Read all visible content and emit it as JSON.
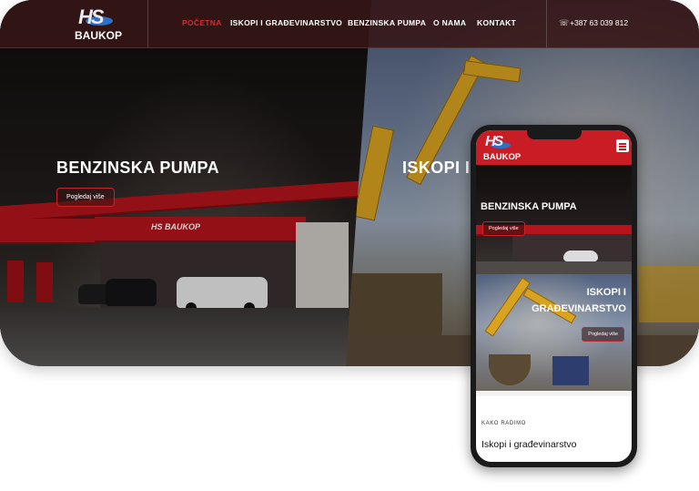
{
  "brand": {
    "mark": "HS",
    "name": "BAUKOP",
    "accent": "#c81d24",
    "logo_blue": "#2d6fc4"
  },
  "nav": {
    "items": [
      {
        "label": "POČETNA",
        "active": true
      },
      {
        "label": "ISKOPI I GRAĐEVINARSTVO",
        "active": false
      },
      {
        "label": "BENZINSKA PUMPA",
        "active": false
      },
      {
        "label": "O NAMA",
        "active": false
      },
      {
        "label": "KONTAKT",
        "active": false
      }
    ],
    "phone": "+387 63 039 812",
    "phone_icon": "phone-icon"
  },
  "hero": {
    "left": {
      "title": "BENZINSKA PUMPA",
      "button": "Pogledaj više"
    },
    "right": {
      "title": "ISKOPI I GRAĐEVINARSTVO"
    }
  },
  "station_sign": "HS BAUKOP",
  "mobile": {
    "menu_icon": "hamburger-icon",
    "slide1": {
      "title": "BENZINSKA PUMPA",
      "button": "Pogledaj više"
    },
    "slide2": {
      "title_line1": "ISKOPI I",
      "title_line2": "GRAĐEVINARSTVO",
      "button": "Pogledaj više"
    },
    "eyebrow": "KAKO RADIMO",
    "heading": "Iskopi i građevinarstvo"
  }
}
